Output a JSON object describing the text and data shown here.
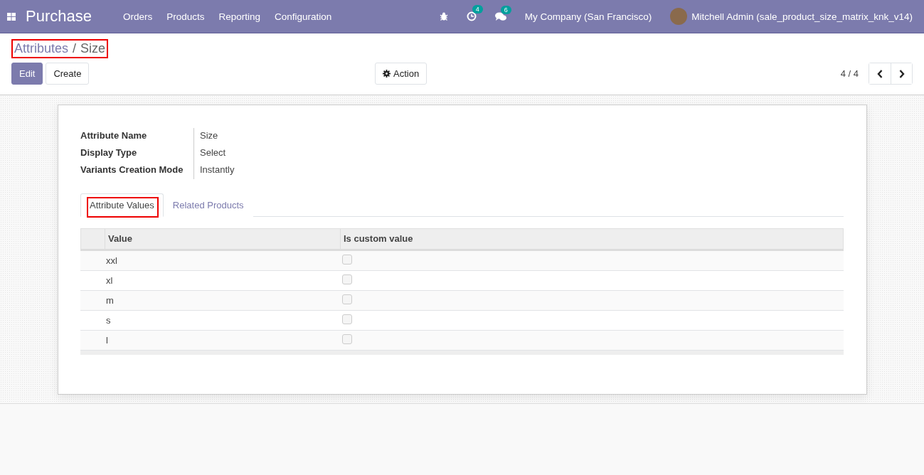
{
  "navbar": {
    "app_title": "Purchase",
    "menu": [
      "Orders",
      "Products",
      "Reporting",
      "Configuration"
    ],
    "activity_count": "4",
    "message_count": "6",
    "company": "My Company (San Francisco)",
    "user": "Mitchell Admin (sale_product_size_matrix_knk_v14)"
  },
  "breadcrumb": {
    "highlighted": true,
    "separator": "/",
    "items": [
      {
        "label": "Attributes",
        "kind": "link"
      },
      {
        "label": "Size",
        "kind": "current"
      }
    ]
  },
  "buttons": {
    "edit": "Edit",
    "create": "Create",
    "action": "Action"
  },
  "pager": {
    "text": "4 / 4"
  },
  "fields": [
    {
      "label": "Attribute Name",
      "value": "Size"
    },
    {
      "label": "Display Type",
      "value": "Select"
    },
    {
      "label": "Variants Creation Mode",
      "value": "Instantly"
    }
  ],
  "tabs": [
    {
      "label": "Attribute Values",
      "selected": true,
      "highlighted": true
    },
    {
      "label": "Related Products",
      "selected": false,
      "highlighted": false
    }
  ],
  "table": {
    "columns": [
      "Value",
      "Is custom value"
    ],
    "rows": [
      {
        "value": "xxl",
        "custom": false
      },
      {
        "value": "xl",
        "custom": false
      },
      {
        "value": "m",
        "custom": false
      },
      {
        "value": "s",
        "custom": false
      },
      {
        "value": "l",
        "custom": false
      }
    ]
  }
}
